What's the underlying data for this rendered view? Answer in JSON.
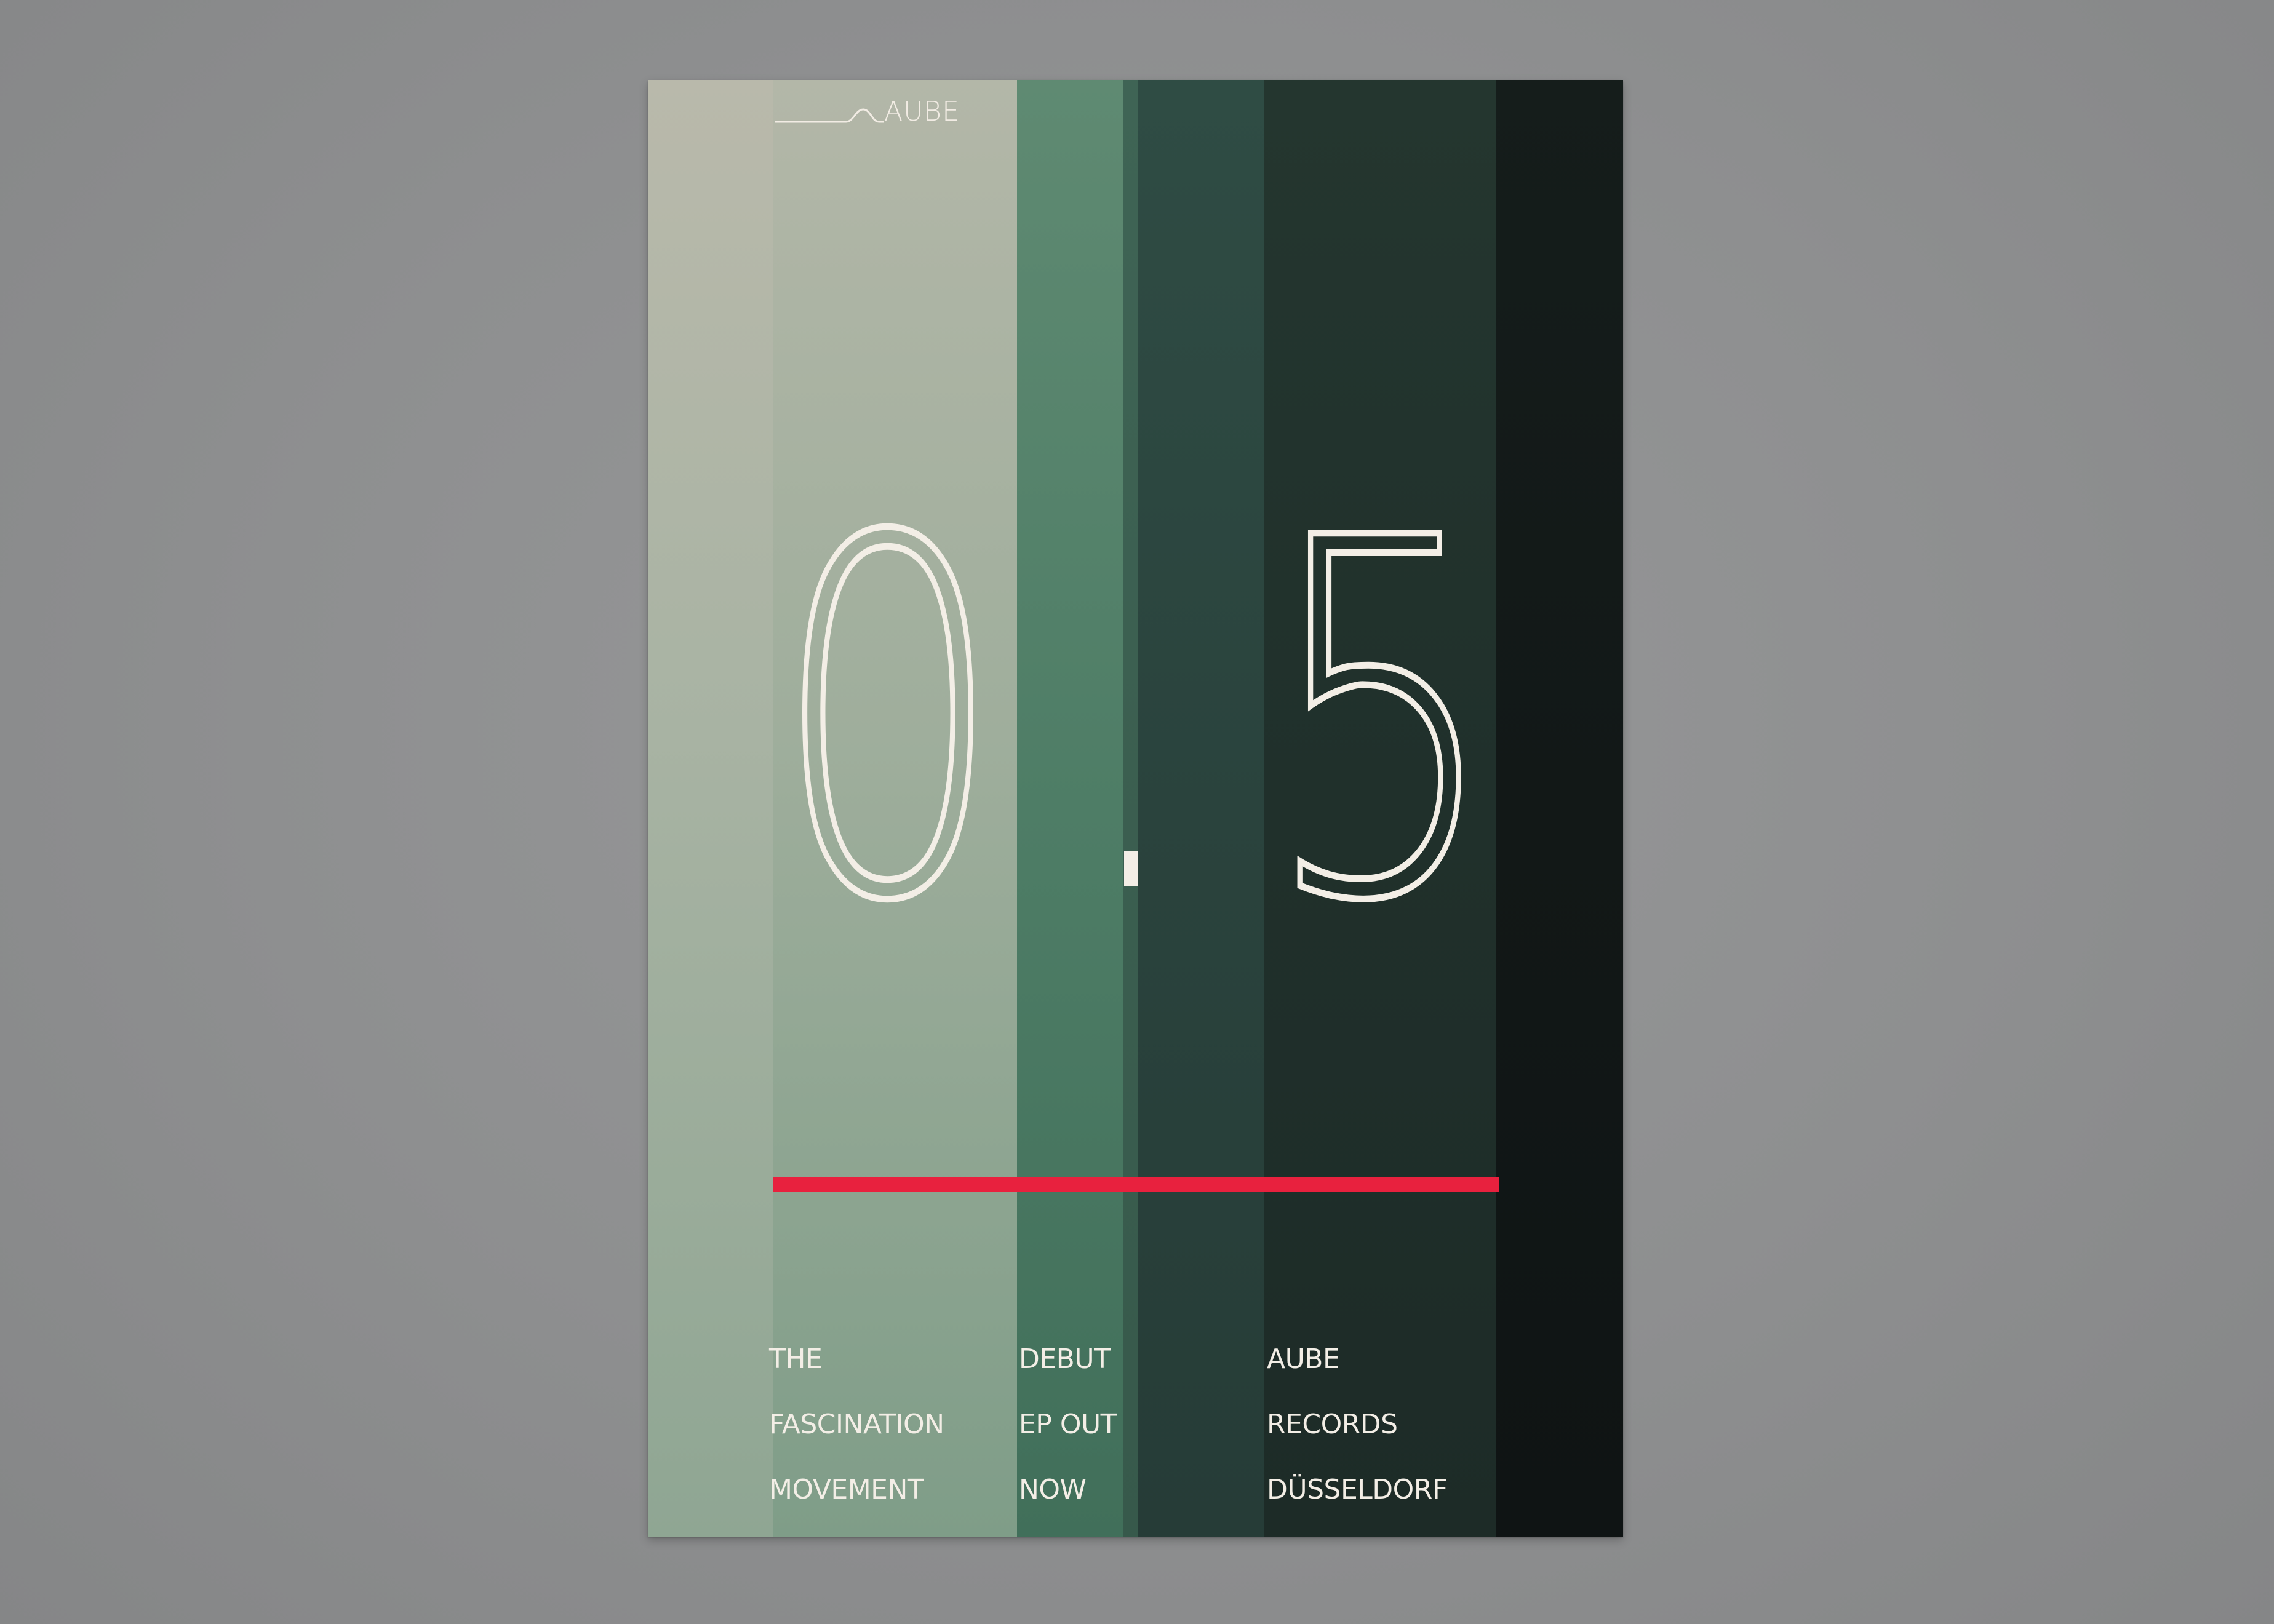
{
  "poster": {
    "logo": {
      "text": "AUBE",
      "mark": "wave-line-icon"
    },
    "headline": {
      "digit_left": "0",
      "separator": ".",
      "digit_right": "5"
    },
    "accent_color": "#e8213e",
    "stripe_colors": [
      "#a8b3a3",
      "#9fae9c",
      "#4e7d66",
      "#37594b",
      "#2a433d",
      "#20302b",
      "#121817"
    ],
    "info_columns": [
      {
        "lines": [
          "THE",
          "FASCINATION",
          "MOVEMENT"
        ]
      },
      {
        "lines": [
          "DEBUT",
          "EP OUT",
          "NOW"
        ]
      },
      {
        "lines": [
          "AUBE",
          "RECORDS",
          "DÜSSELDORF"
        ]
      }
    ]
  }
}
